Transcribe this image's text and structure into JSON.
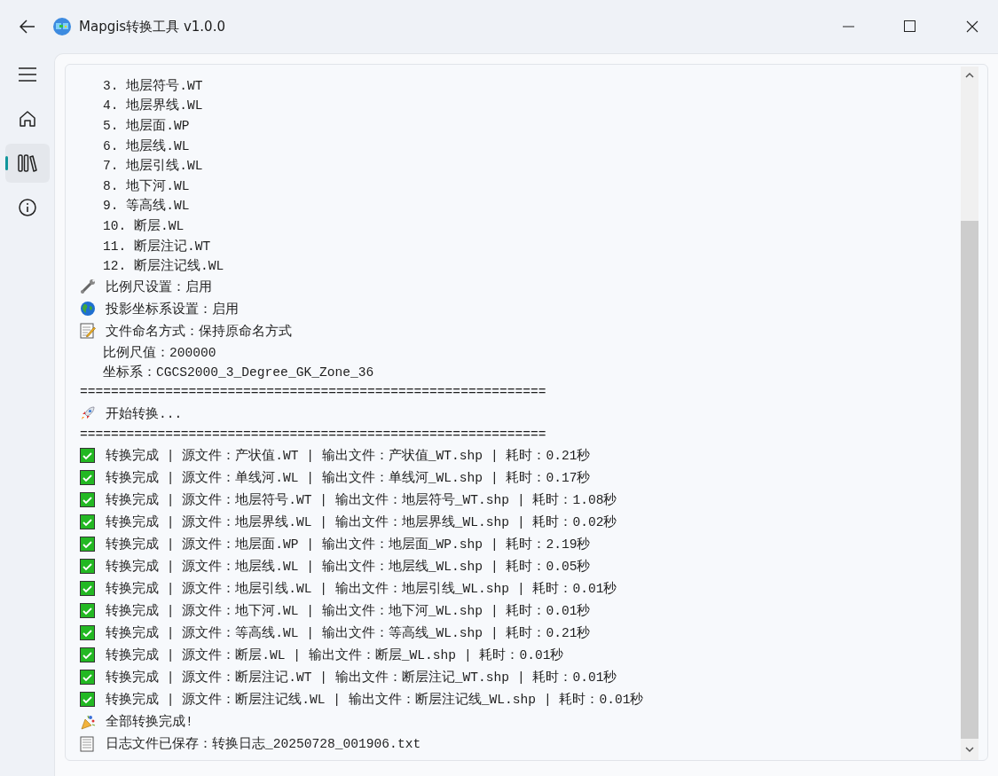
{
  "window": {
    "title": "Mapgis转换工具 v1.0.0"
  },
  "sidebar": {
    "items": [
      {
        "kind": "menu",
        "selected": false
      },
      {
        "kind": "home",
        "selected": false
      },
      {
        "kind": "library",
        "selected": true
      },
      {
        "kind": "info",
        "selected": false
      }
    ]
  },
  "log": {
    "lines": [
      {
        "kind": "list-item",
        "text": "3. 地层符号.WT"
      },
      {
        "kind": "list-item",
        "text": "4. 地层界线.WL"
      },
      {
        "kind": "list-item",
        "text": "5. 地层面.WP"
      },
      {
        "kind": "list-item",
        "text": "6. 地层线.WL"
      },
      {
        "kind": "list-item",
        "text": "7. 地层引线.WL"
      },
      {
        "kind": "list-item",
        "text": "8. 地下河.WL"
      },
      {
        "kind": "list-item",
        "text": "9. 等高线.WL"
      },
      {
        "kind": "list-item",
        "text": "10. 断层.WL"
      },
      {
        "kind": "list-item",
        "text": "11. 断层注记.WT"
      },
      {
        "kind": "list-item",
        "text": "12. 断层注记线.WL"
      },
      {
        "kind": "wrench",
        "text": "比例尺设置：启用"
      },
      {
        "kind": "globe",
        "text": "投影坐标系设置：启用"
      },
      {
        "kind": "memo",
        "text": "文件命名方式：保持原命名方式"
      },
      {
        "kind": "detail",
        "text": "比例尺值：200000"
      },
      {
        "kind": "detail",
        "text": "坐标系：CGCS2000_3_Degree_GK_Zone_36"
      },
      {
        "kind": "plain",
        "text": "============================================================"
      },
      {
        "kind": "rocket",
        "text": "开始转换..."
      },
      {
        "kind": "plain",
        "text": "============================================================"
      },
      {
        "kind": "check",
        "text": "转换完成 | 源文件：产状值.WT | 输出文件：产状值_WT.shp | 耗时：0.21秒"
      },
      {
        "kind": "check",
        "text": "转换完成 | 源文件：单线河.WL | 输出文件：单线河_WL.shp | 耗时：0.17秒"
      },
      {
        "kind": "check",
        "text": "转换完成 | 源文件：地层符号.WT | 输出文件：地层符号_WT.shp | 耗时：1.08秒"
      },
      {
        "kind": "check",
        "text": "转换完成 | 源文件：地层界线.WL | 输出文件：地层界线_WL.shp | 耗时：0.02秒"
      },
      {
        "kind": "check",
        "text": "转换完成 | 源文件：地层面.WP | 输出文件：地层面_WP.shp | 耗时：2.19秒"
      },
      {
        "kind": "check",
        "text": "转换完成 | 源文件：地层线.WL | 输出文件：地层线_WL.shp | 耗时：0.05秒"
      },
      {
        "kind": "check",
        "text": "转换完成 | 源文件：地层引线.WL | 输出文件：地层引线_WL.shp | 耗时：0.01秒"
      },
      {
        "kind": "check",
        "text": "转换完成 | 源文件：地下河.WL | 输出文件：地下河_WL.shp | 耗时：0.01秒"
      },
      {
        "kind": "check",
        "text": "转换完成 | 源文件：等高线.WL | 输出文件：等高线_WL.shp | 耗时：0.21秒"
      },
      {
        "kind": "check",
        "text": "转换完成 | 源文件：断层.WL | 输出文件：断层_WL.shp | 耗时：0.01秒"
      },
      {
        "kind": "check",
        "text": "转换完成 | 源文件：断层注记.WT | 输出文件：断层注记_WT.shp | 耗时：0.01秒"
      },
      {
        "kind": "check",
        "text": "转换完成 | 源文件：断层注记线.WL | 输出文件：断层注记线_WL.shp | 耗时：0.01秒"
      },
      {
        "kind": "party",
        "text": "全部转换完成!"
      },
      {
        "kind": "document",
        "text": "日志文件已保存：转换日志_20250728_001906.txt"
      }
    ]
  }
}
